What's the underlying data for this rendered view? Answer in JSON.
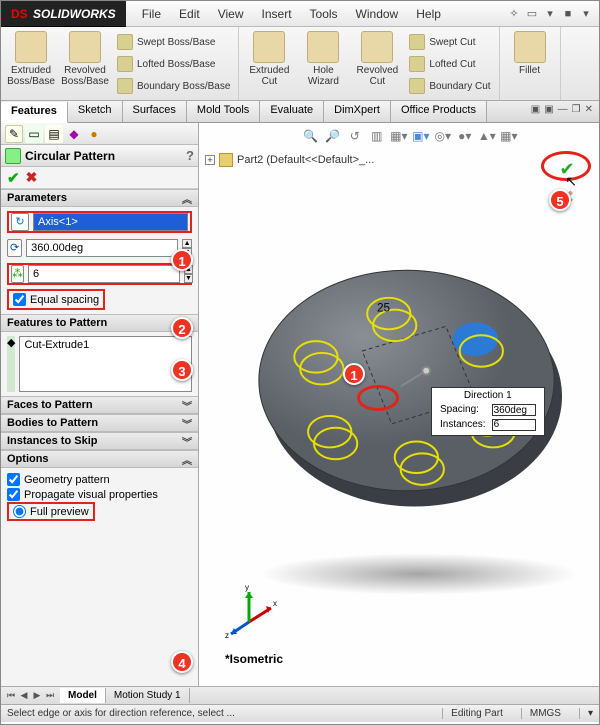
{
  "app": {
    "brand": "SOLIDWORKS"
  },
  "menus": [
    "File",
    "Edit",
    "View",
    "Insert",
    "Tools",
    "Window",
    "Help"
  ],
  "ribbon": {
    "g1": {
      "a": "Extruded Boss/Base",
      "b": "Revolved Boss/Base",
      "l1": "Swept Boss/Base",
      "l2": "Lofted Boss/Base",
      "l3": "Boundary Boss/Base"
    },
    "g2": {
      "a": "Extruded Cut",
      "b": "Hole Wizard",
      "c": "Revolved Cut",
      "l1": "Swept Cut",
      "l2": "Lofted Cut",
      "l3": "Boundary Cut"
    },
    "g3": {
      "a": "Fillet"
    }
  },
  "feature_tabs": [
    "Features",
    "Sketch",
    "Surfaces",
    "Mold Tools",
    "Evaluate",
    "DimXpert",
    "Office Products"
  ],
  "pm": {
    "title": "Circular Pattern",
    "sections": {
      "parameters": "Parameters",
      "features": "Features to Pattern",
      "faces": "Faces to Pattern",
      "bodies": "Bodies to Pattern",
      "skip": "Instances to Skip",
      "options": "Options"
    },
    "axis": "Axis<1>",
    "angle": "360.00deg",
    "count": "6",
    "equal_spacing": "Equal spacing",
    "feature_item": "Cut-Extrude1",
    "opt_geom": "Geometry pattern",
    "opt_prop": "Propagate visual properties",
    "opt_full": "Full preview"
  },
  "tree_node": "Part2 (Default<<Default>_...",
  "direction_box": {
    "title": "Direction 1",
    "spacing_lbl": "Spacing:",
    "spacing": "360deg",
    "inst_lbl": "Instances:",
    "inst": "6"
  },
  "disc_dim": "25",
  "iso": "*Isometric",
  "bottom_tabs": [
    "Model",
    "Motion Study 1"
  ],
  "status": {
    "hint": "Select edge or axis for direction reference, select ...",
    "mode": "Editing Part",
    "units": "MMGS"
  }
}
